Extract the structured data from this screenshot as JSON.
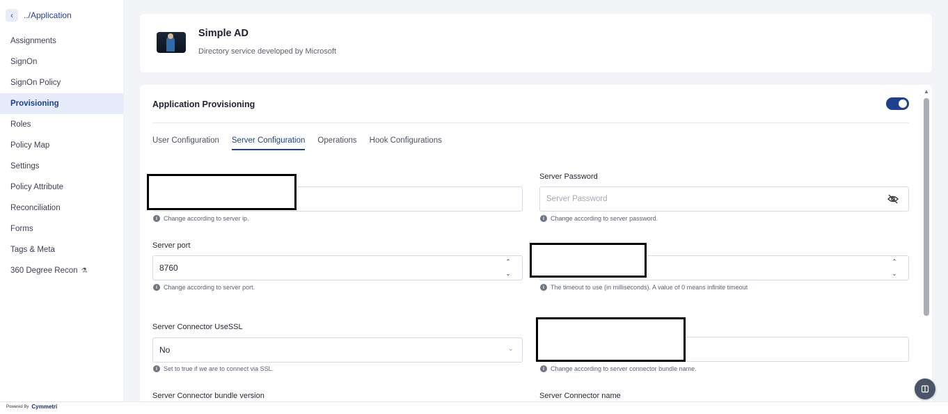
{
  "sidebar": {
    "back_label": "../Application",
    "items": [
      {
        "label": "Assignments"
      },
      {
        "label": "SignOn"
      },
      {
        "label": "SignOn Policy"
      },
      {
        "label": "Provisioning",
        "active": true
      },
      {
        "label": "Roles"
      },
      {
        "label": "Policy Map"
      },
      {
        "label": "Settings"
      },
      {
        "label": "Policy Attribute"
      },
      {
        "label": "Reconciliation"
      },
      {
        "label": "Forms"
      },
      {
        "label": "Tags & Meta"
      },
      {
        "label": "360 Degree Recon"
      }
    ],
    "powered_by": "Powered By",
    "brand": "Cymmetri"
  },
  "app": {
    "title": "Simple AD",
    "description": "Directory service developed by Microsoft"
  },
  "provisioning": {
    "title": "Application Provisioning",
    "enabled": true,
    "tabs": [
      {
        "label": "User Configuration"
      },
      {
        "label": "Server Configuration",
        "active": true
      },
      {
        "label": "Operations"
      },
      {
        "label": "Hook Configurations"
      }
    ],
    "fields": {
      "server_ip_help": "Change according to server ip.",
      "server_password_label": "Server Password",
      "server_password_placeholder": "Server Password",
      "server_password_help": "Change according to server password.",
      "server_port_label": "Server port",
      "server_port_value": "8760",
      "server_port_help": "Change according to server port.",
      "timeout_help": "The timeout to use (in milliseconds). A value of 0 means infinite timeout",
      "usessl_label": "Server Connector UseSSL",
      "usessl_value": "No",
      "usessl_help": "Set to true if we are to connect via SSL.",
      "bundle_name_help": "Change according to server connector bundle name.",
      "bundle_version_label": "Server Connector bundle version",
      "connector_name_label": "Server Connector name"
    }
  },
  "colors": {
    "accent": "#1f3f8f",
    "active_nav_bg": "#e7ecfb",
    "main_bg": "#f2f4f8"
  }
}
